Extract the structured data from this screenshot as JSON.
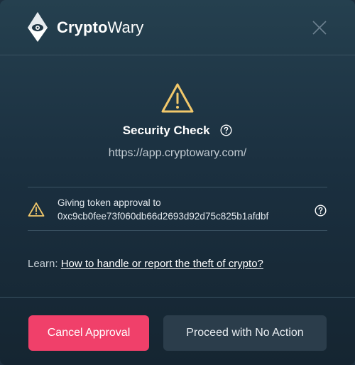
{
  "header": {
    "brand_bold": "Crypto",
    "brand_regular": "Wary",
    "logo_icon": "eye-diamond-icon",
    "close_icon": "close-icon"
  },
  "security": {
    "warning_icon": "warning-triangle-icon",
    "title": "Security Check",
    "help_icon": "question-circle-icon",
    "url": "https://app.cryptowary.com/"
  },
  "alert": {
    "icon": "warning-triangle-icon",
    "line1": "Giving token approval to",
    "line2": "0xc9cb0fee73f060db66d2693d92d75c825b1afdbf",
    "help_icon": "question-circle-icon"
  },
  "learn": {
    "prefix": "Learn:",
    "link_text": "How to handle or report the theft of crypto?"
  },
  "footer": {
    "cancel_label": "Cancel Approval",
    "proceed_label": "Proceed with No Action"
  },
  "colors": {
    "accent_warning": "#f1c86b",
    "cancel_bg": "#f0406a",
    "proceed_bg": "#2b3d4b"
  }
}
